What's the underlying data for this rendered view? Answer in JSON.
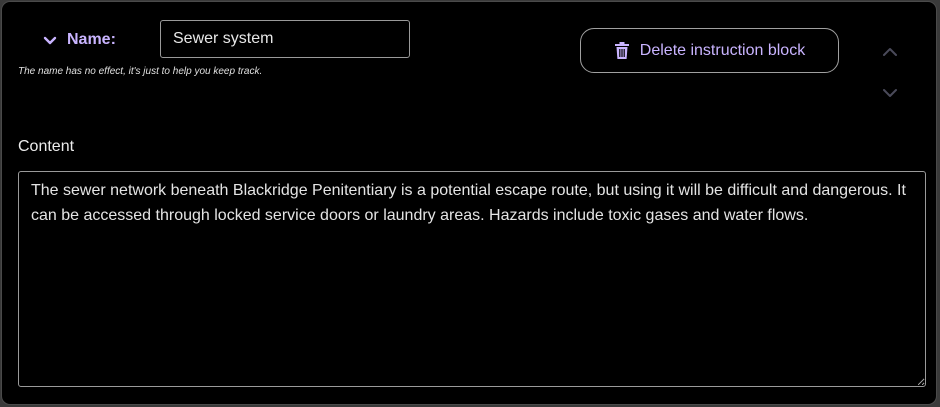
{
  "block": {
    "name_label": "Name:",
    "name_value": "Sewer system",
    "name_hint": "The name has no effect, it's just to help you keep track.",
    "delete_label": "Delete instruction block",
    "content_label": "Content",
    "content_value": "The sewer network beneath Blackridge Penitentiary is a potential escape route, but using it will be difficult and dangerous. It can be accessed through locked service doors or laundry areas. Hazards include toxic gases and water flows."
  },
  "icons": {
    "collapse": "chevron-down-icon",
    "delete": "trash-icon",
    "move_up": "chevron-up-icon",
    "move_down": "chevron-down-icon"
  },
  "colors": {
    "accent": "#c9b4ff",
    "background": "#000000",
    "border": "#9a9a9a",
    "muted_arrow": "#4a4a5a"
  }
}
